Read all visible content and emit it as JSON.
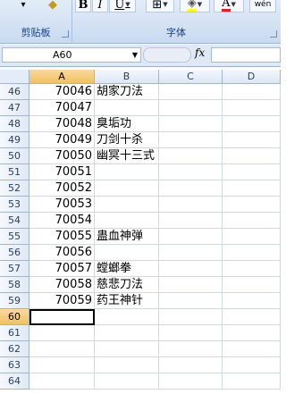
{
  "ribbon": {
    "clipboard_label": "剪贴板",
    "font_label": "字体",
    "bold": "B",
    "italic": "I",
    "underline": "U",
    "wen": "wén"
  },
  "formula_bar": {
    "name_box": "A60",
    "fx": "fx",
    "formula": ""
  },
  "columns": [
    "A",
    "B",
    "C",
    "D"
  ],
  "selected_cell": "A60",
  "rows": [
    {
      "n": "46",
      "a": "70046",
      "b": "胡家刀法"
    },
    {
      "n": "47",
      "a": "70047",
      "b": ""
    },
    {
      "n": "48",
      "a": "70048",
      "b": "臭垢功"
    },
    {
      "n": "49",
      "a": "70049",
      "b": "刀剑十杀"
    },
    {
      "n": "50",
      "a": "70050",
      "b": "幽冥十三式"
    },
    {
      "n": "51",
      "a": "70051",
      "b": ""
    },
    {
      "n": "52",
      "a": "70052",
      "b": ""
    },
    {
      "n": "53",
      "a": "70053",
      "b": ""
    },
    {
      "n": "54",
      "a": "70054",
      "b": ""
    },
    {
      "n": "55",
      "a": "70055",
      "b": "蛊血神弹"
    },
    {
      "n": "56",
      "a": "70056",
      "b": ""
    },
    {
      "n": "57",
      "a": "70057",
      "b": "螳螂拳"
    },
    {
      "n": "58",
      "a": "70058",
      "b": "慈悲刀法"
    },
    {
      "n": "59",
      "a": "70059",
      "b": "药王神针"
    },
    {
      "n": "60",
      "a": "",
      "b": ""
    },
    {
      "n": "61",
      "a": "",
      "b": ""
    },
    {
      "n": "62",
      "a": "",
      "b": ""
    },
    {
      "n": "63",
      "a": "",
      "b": ""
    },
    {
      "n": "64",
      "a": "",
      "b": ""
    }
  ]
}
